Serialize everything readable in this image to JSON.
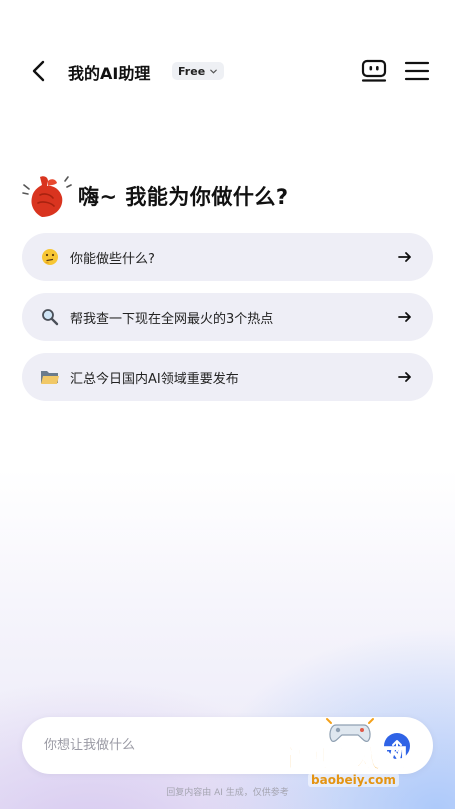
{
  "header": {
    "title": "我的AI助理",
    "plan_badge": "Free"
  },
  "greeting": {
    "text": "嗨~ 我能为你做什么?"
  },
  "suggestions": [
    {
      "label": "你能做些什么?",
      "icon": "thinking-face-emoji"
    },
    {
      "label": "帮我查一下现在全网最火的3个热点",
      "icon": "magnifier-emoji"
    },
    {
      "label": "汇总今日国内AI领域重要发布",
      "icon": "folder-emoji"
    }
  ],
  "input": {
    "placeholder": "你想让我做什么"
  },
  "disclaimer": "回复内容由 AI 生成，仅供参考",
  "watermark": {
    "text": "宝贝游戏网",
    "url": "baobeiy.com"
  },
  "colors": {
    "accent": "#2f63e6",
    "suggestion_bg": "#eeeef6",
    "lobster": "#d9341f"
  }
}
